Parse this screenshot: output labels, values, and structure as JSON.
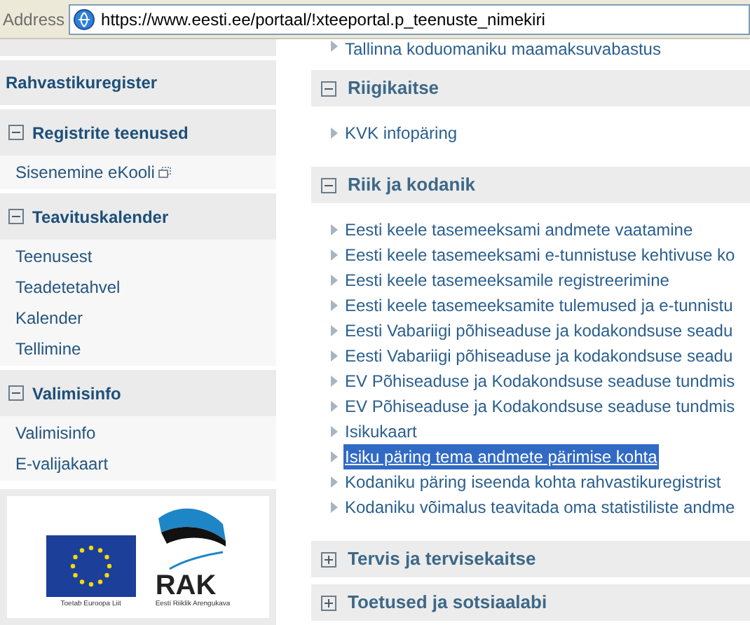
{
  "address_bar": {
    "label": "Address",
    "url": "https://www.eesti.ee/portaal/!xteeportal.p_teenuste_nimekiri"
  },
  "sidebar": {
    "sections": [
      {
        "kind": "link",
        "title": "Rahvastikuregister"
      },
      {
        "kind": "group",
        "title": "Registrite teenused",
        "expanded": true,
        "items": [
          {
            "label": "Sisenemine eKooli",
            "external": true
          }
        ]
      },
      {
        "kind": "group",
        "title": "Teavituskalender",
        "expanded": true,
        "items": [
          {
            "label": "Teenusest",
            "external": false
          },
          {
            "label": "Teadetetahvel",
            "external": false
          },
          {
            "label": "Kalender",
            "external": false
          },
          {
            "label": "Tellimine",
            "external": false
          }
        ]
      },
      {
        "kind": "group",
        "title": "Valimisinfo",
        "expanded": true,
        "items": [
          {
            "label": "Valimisinfo",
            "external": false
          },
          {
            "label": "E-valijakaart",
            "external": false
          }
        ]
      }
    ],
    "logos": {
      "eu_caption": "Toetab Euroopa Liit",
      "rak_name": "RAK",
      "rak_caption": "Eesti Riiklik Arengukava"
    }
  },
  "main": {
    "top_item": "Tallinna koduomaniku maamaksuvabastus",
    "sections": [
      {
        "title": "Riigikaitse",
        "expanded": true,
        "items": [
          {
            "label": "KVK infopäring",
            "selected": false
          }
        ]
      },
      {
        "title": "Riik ja kodanik",
        "expanded": true,
        "items": [
          {
            "label": "Eesti keele tasemeeksami andmete vaatamine",
            "selected": false
          },
          {
            "label": "Eesti keele tasemeeksami e-tunnistuse kehtivuse ko",
            "selected": false
          },
          {
            "label": "Eesti keele tasemeeksamile registreerimine",
            "selected": false
          },
          {
            "label": "Eesti keele tasemeeksamite tulemused ja e-tunnistu",
            "selected": false
          },
          {
            "label": "Eesti Vabariigi põhiseaduse ja kodakondsuse seadu",
            "selected": false
          },
          {
            "label": "Eesti Vabariigi põhiseaduse ja kodakondsuse seadu",
            "selected": false
          },
          {
            "label": "EV Põhiseaduse ja Kodakondsuse seaduse tundmis",
            "selected": false
          },
          {
            "label": "EV Põhiseaduse ja Kodakondsuse seaduse tundmis",
            "selected": false
          },
          {
            "label": "Isikukaart",
            "selected": false
          },
          {
            "label": "Isiku päring tema andmete pärimise kohta",
            "selected": true
          },
          {
            "label": "Kodaniku päring iseenda kohta rahvastikuregistrist",
            "selected": false
          },
          {
            "label": "Kodaniku võimalus teavitada oma statistiliste andme",
            "selected": false
          }
        ]
      },
      {
        "title": "Tervis ja tervisekaitse",
        "expanded": false
      },
      {
        "title": "Toetused ja sotsiaalabi",
        "expanded": false
      }
    ]
  }
}
